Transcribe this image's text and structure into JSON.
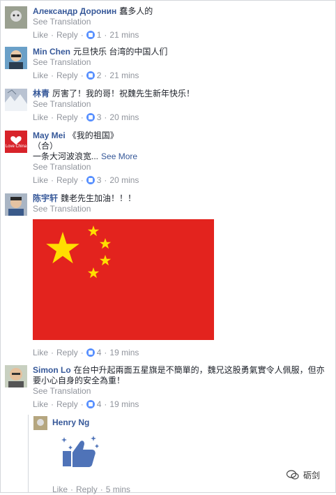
{
  "comments": [
    {
      "author": "Александр Доронин",
      "text": "蠢多人的",
      "see_translation": "See Translation",
      "like": "Like",
      "reply": "Reply",
      "count": "1",
      "time": "21 mins"
    },
    {
      "author": "Min Chen",
      "text": "元旦快乐 台湾的中国人们",
      "see_translation": "See Translation",
      "like": "Like",
      "reply": "Reply",
      "count": "2",
      "time": "21 mins"
    },
    {
      "author": "林青",
      "text": "厉害了！我的哥！祝魏先生新年快乐！",
      "see_translation": "See Translation",
      "like": "Like",
      "reply": "Reply",
      "count": "3",
      "time": "20 mins"
    },
    {
      "author": "May Mei",
      "text": "《我的祖国》",
      "line2": "（合）",
      "line3": "一条大河波浪宽...",
      "see_more": "See More",
      "avatar_text": "Love China",
      "see_translation": "See Translation",
      "like": "Like",
      "reply": "Reply",
      "count": "3",
      "time": "20 mins"
    },
    {
      "author": "陈宇轩",
      "text": "魏老先生加油！！！",
      "see_translation": "See Translation",
      "like": "Like",
      "reply": "Reply",
      "count": "4",
      "time": "19 mins"
    },
    {
      "author": "Simon Lo",
      "text": "在台中升起兩面五星旗是不簡單的，魏兄这股勇氣實令人佩服，但亦要小心自身的安全為重！",
      "see_translation": "See Translation",
      "like": "Like",
      "reply": "Reply",
      "count": "4",
      "time": "19 mins"
    }
  ],
  "reply": {
    "author": "Henry Ng",
    "like": "Like",
    "reply": "Reply",
    "time": "5 mins"
  },
  "watermark": "砺剑",
  "colors": {
    "link": "#365899",
    "meta": "#90949c",
    "flag_red": "#e3231e",
    "flag_yellow": "#ffde00",
    "reaction_blue": "#5890ff"
  },
  "icons": [
    "like-reaction-icon",
    "china-flag",
    "thumbs-up-sticker-icon",
    "wechat-icon"
  ]
}
